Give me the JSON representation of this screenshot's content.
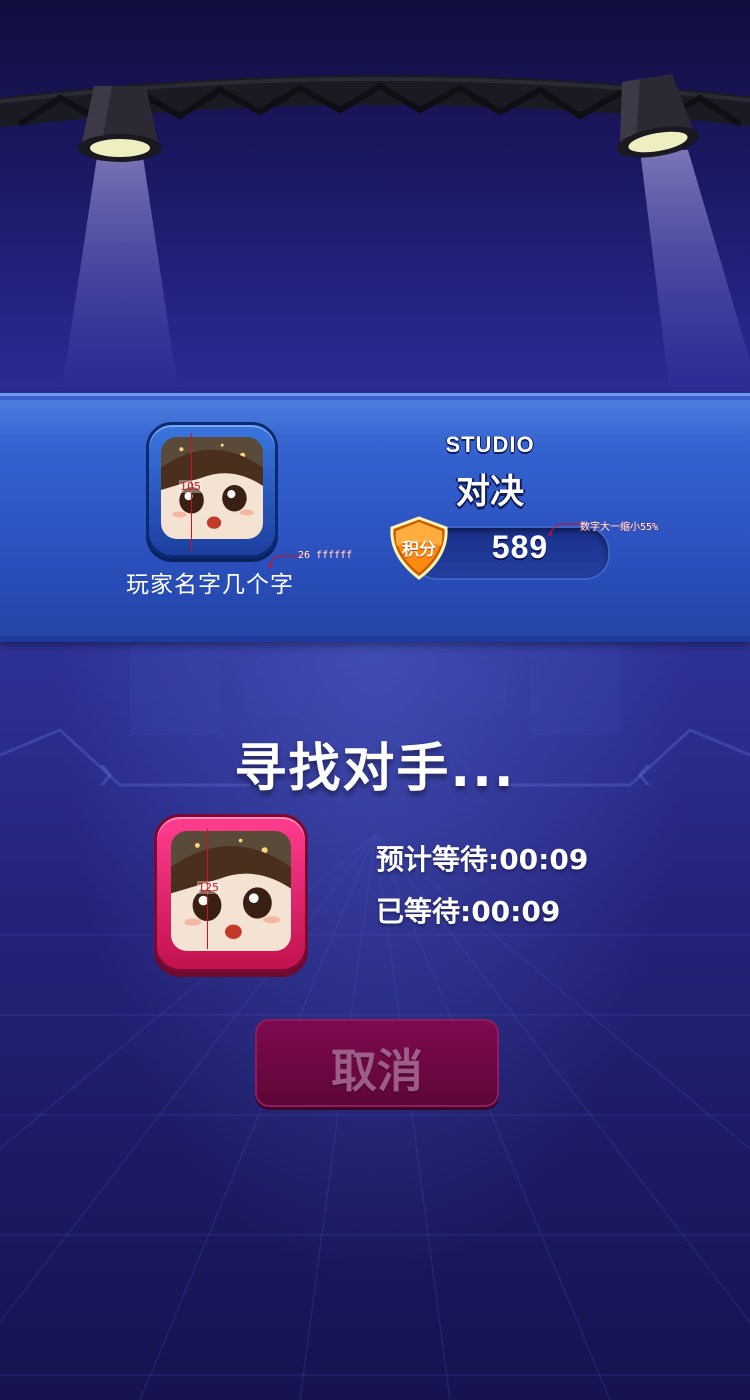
{
  "player": {
    "name": "玩家名字几个字",
    "avatar_size_note": "105",
    "name_style_note": "26 ffffff"
  },
  "mode": {
    "subtitle": "STUDIO",
    "title": "对决"
  },
  "score": {
    "badge_label": "积分",
    "value": "589",
    "note": "数字大一缩小55%"
  },
  "matchmaking": {
    "status": "寻找对手...",
    "estimated_wait": "预计等待:00:09",
    "elapsed_wait": "已等待:00:09",
    "opponent_avatar_size_note": "125"
  },
  "actions": {
    "cancel_label": "取消"
  },
  "colors": {
    "banner": "#3563d0",
    "player_frame": "#2b5fd0",
    "opponent_frame": "#e0246f",
    "cancel_button": "#6e0843",
    "badge": "#ff8a12",
    "annotation": "#d4101a"
  },
  "icons": [
    "stage-truss-icon",
    "spotlight-icon",
    "points-badge-icon",
    "player-avatar-icon",
    "opponent-avatar-icon"
  ]
}
